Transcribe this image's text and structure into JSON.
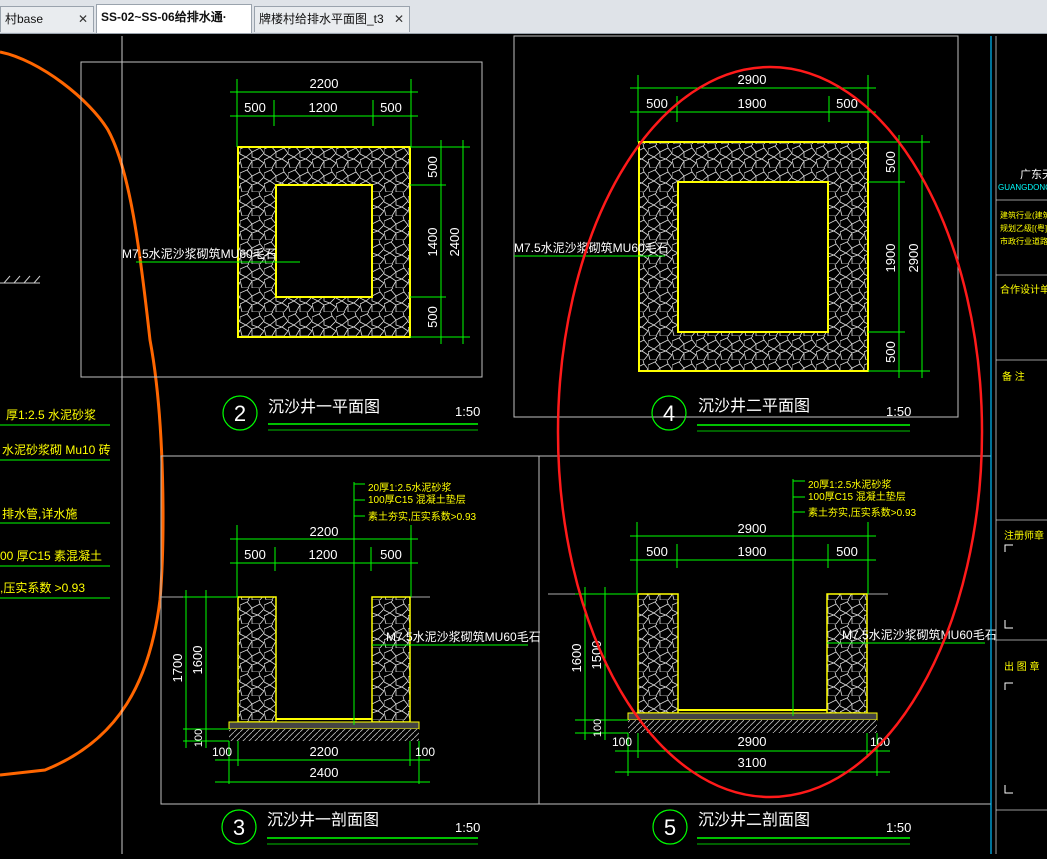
{
  "tabs": [
    {
      "label": "村base"
    },
    {
      "label": "SS-02~SS-06给排水通·"
    },
    {
      "label": "牌楼村给排水平面图_t3"
    }
  ],
  "colors": {
    "dim": "#00ff00",
    "yellow": "#ffff00",
    "white": "#ffffff",
    "red": "#ff0000",
    "orange": "#ff6600",
    "cyan": "#00ffff"
  },
  "left_notes": [
    "厚1:2.5  水泥砂浆",
    "水泥砂浆砌  Mu10  砖",
    "排水管,详水施",
    "00  厚C15  素混凝土",
    ",压实系数      >0.93"
  ],
  "plan1": {
    "num": "2",
    "title": "沉沙井一平面图",
    "scale": "1:50",
    "dims_top": [
      "2200",
      "500",
      "1200",
      "500"
    ],
    "dims_right": [
      "500",
      "1400",
      "500",
      "2400"
    ],
    "label": "M7.5水泥沙浆砌筑MU60毛石"
  },
  "plan2": {
    "num": "4",
    "title": "沉沙井二平面图",
    "scale": "1:50",
    "dims_top": [
      "2900",
      "500",
      "1900",
      "500"
    ],
    "dims_right": [
      "500",
      "1900",
      "500",
      "2900"
    ],
    "label": "M7.5水泥沙浆砌筑MU60毛石"
  },
  "sec1": {
    "num": "3",
    "title": "沉沙井一剖面图",
    "scale": "1:50",
    "notes": [
      "20厚1:2.5水泥砂浆",
      "100厚C15 混凝土垫层",
      "素土夯实,压实系数>0.93"
    ],
    "dims_top": [
      "2200",
      "500",
      "1200",
      "500"
    ],
    "dims_left": [
      "1700",
      "1600",
      "100"
    ],
    "dims_bottom": [
      "100",
      "2200",
      "100",
      "2400"
    ],
    "label": "M7.5水泥沙浆砌筑MU60毛石"
  },
  "sec2": {
    "num": "5",
    "title": "沉沙井二剖面图",
    "scale": "1:50",
    "notes": [
      "20厚1:2.5水泥砂浆",
      "100厚C15 混凝土垫层",
      "素土夯实,压实系数>0.93"
    ],
    "dims_top": [
      "2900",
      "500",
      "1900",
      "500"
    ],
    "dims_left": [
      "1600",
      "1500",
      "100"
    ],
    "dims_bottom": [
      "100",
      "2900",
      "100",
      "3100"
    ],
    "label": "M7.5水泥沙浆砌筑MU60毛石"
  },
  "titleblock": {
    "company": "广东天",
    "company_en": "GUANGDONG",
    "cert1": "建筑行业(建筑工",
    "cert2": "规划乙级[(粤]",
    "cert3": "市政行业道路工程",
    "partner": "合作设计单位",
    "remark": "备    注",
    "reg": "注册师章",
    "stamp": "出 图 章"
  }
}
